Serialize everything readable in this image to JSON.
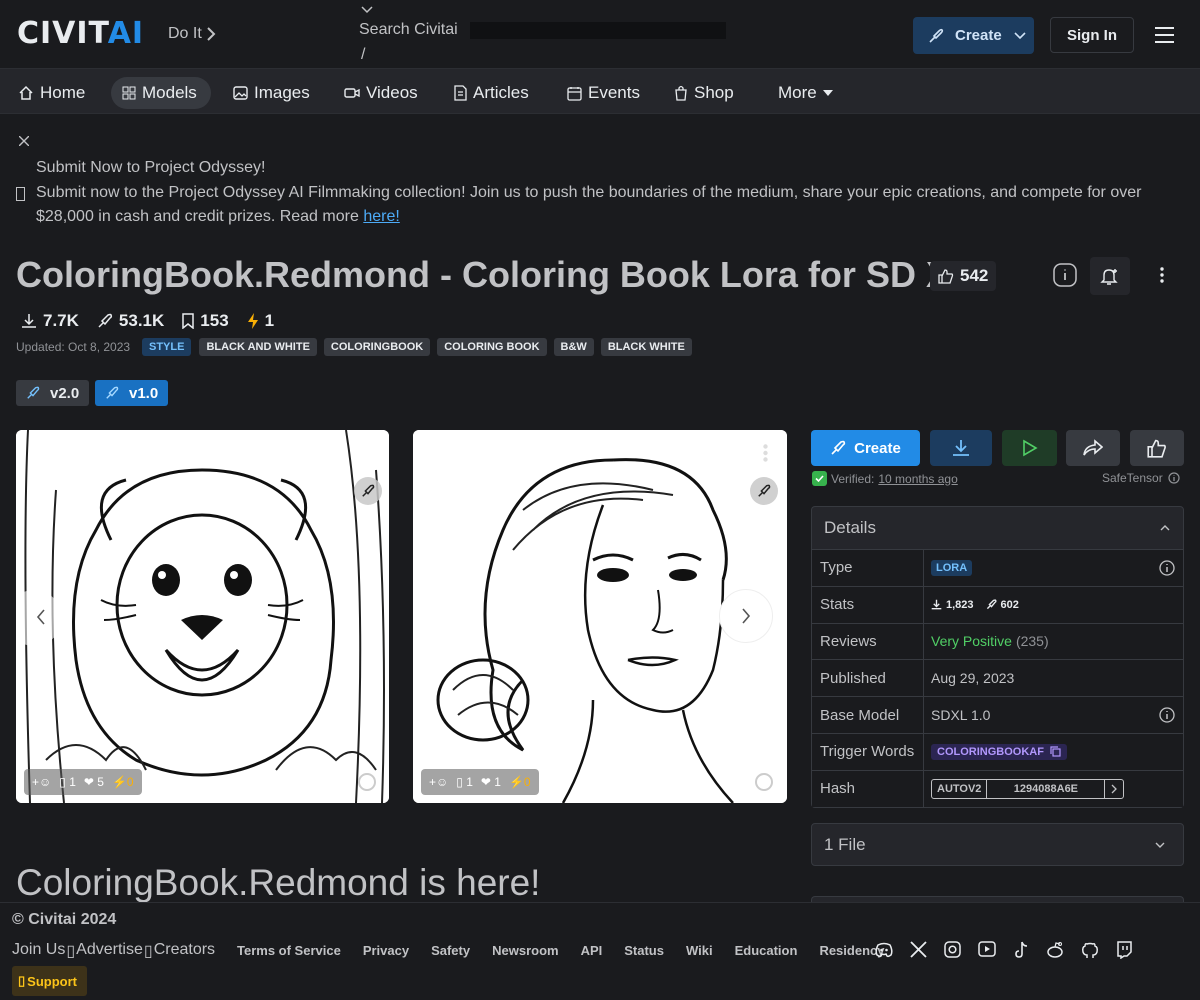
{
  "header": {
    "logo_main": "CIVIT",
    "logo_ai": "AI",
    "doit_label": "Do It",
    "search_placeholder": "Search Civitai",
    "search_hotkey": "/",
    "create_label": "Create",
    "signin_label": "Sign In"
  },
  "nav": {
    "items": [
      {
        "label": "Home"
      },
      {
        "label": "Models"
      },
      {
        "label": "Images"
      },
      {
        "label": "Videos"
      },
      {
        "label": "Articles"
      },
      {
        "label": "Events"
      },
      {
        "label": "Shop"
      },
      {
        "label": "More"
      }
    ]
  },
  "announcement": {
    "title": "Submit Now to Project Odyssey!",
    "body": "Submit now to the Project Odyssey AI Filmmaking collection! Join us to push the boundaries of the medium, share your epic creations, and compete for over $28,000 in cash and credit prizes. Read more",
    "link": "here!"
  },
  "model": {
    "title": "ColoringBook.Redmond - Coloring Book Lora for SD XL",
    "likes": "542",
    "downloads": "7.7K",
    "generations": "53.1K",
    "bookmarks": "153",
    "buzz": "1",
    "updated": "Updated: Oct 8, 2023",
    "tags": [
      "STYLE",
      "BLACK AND WHITE",
      "COLORINGBOOK",
      "COLORING BOOK",
      "B&W",
      "BLACK WHITE"
    ],
    "versions": [
      "v2.0",
      "v1.0"
    ]
  },
  "gallery": {
    "cards": [
      {
        "comments": "1",
        "likes": "5",
        "buzz": "0"
      },
      {
        "comments": "1",
        "likes": "1",
        "buzz": "0"
      }
    ]
  },
  "actions": {
    "create_label": "Create",
    "verified_label": "Verified:",
    "verified_when": "10 months ago",
    "safetensor_label": "SafeTensor"
  },
  "details": {
    "heading": "Details",
    "type_label": "Type",
    "type_value": "LORA",
    "stats_label": "Stats",
    "stats_downloads": "1,823",
    "stats_generations": "602",
    "reviews_label": "Reviews",
    "reviews_value": "Very Positive",
    "reviews_count": "(235)",
    "published_label": "Published",
    "published_value": "Aug 29, 2023",
    "base_label": "Base Model",
    "base_value": "SDXL 1.0",
    "trigger_label": "Trigger Words",
    "trigger_value": "COLORINGBOOKAF",
    "hash_label": "Hash",
    "hash_type": "AUTOV2",
    "hash_value": "1294088A6E"
  },
  "files": {
    "heading": "1 File"
  },
  "description": {
    "heading": "ColoringBook.Redmond is here!"
  },
  "footer": {
    "copyright": "© Civitai 2024",
    "join_us": "Join Us",
    "advertise": "Advertise",
    "creators": "Creators",
    "links": [
      "Terms of Service",
      "Privacy",
      "Safety",
      "Newsroom",
      "API",
      "Status",
      "Wiki",
      "Education",
      "Residency"
    ],
    "support": "Support"
  },
  "colors": {
    "background": "#1a1b1e",
    "accent": "#228be6",
    "success": "#37b24d"
  }
}
